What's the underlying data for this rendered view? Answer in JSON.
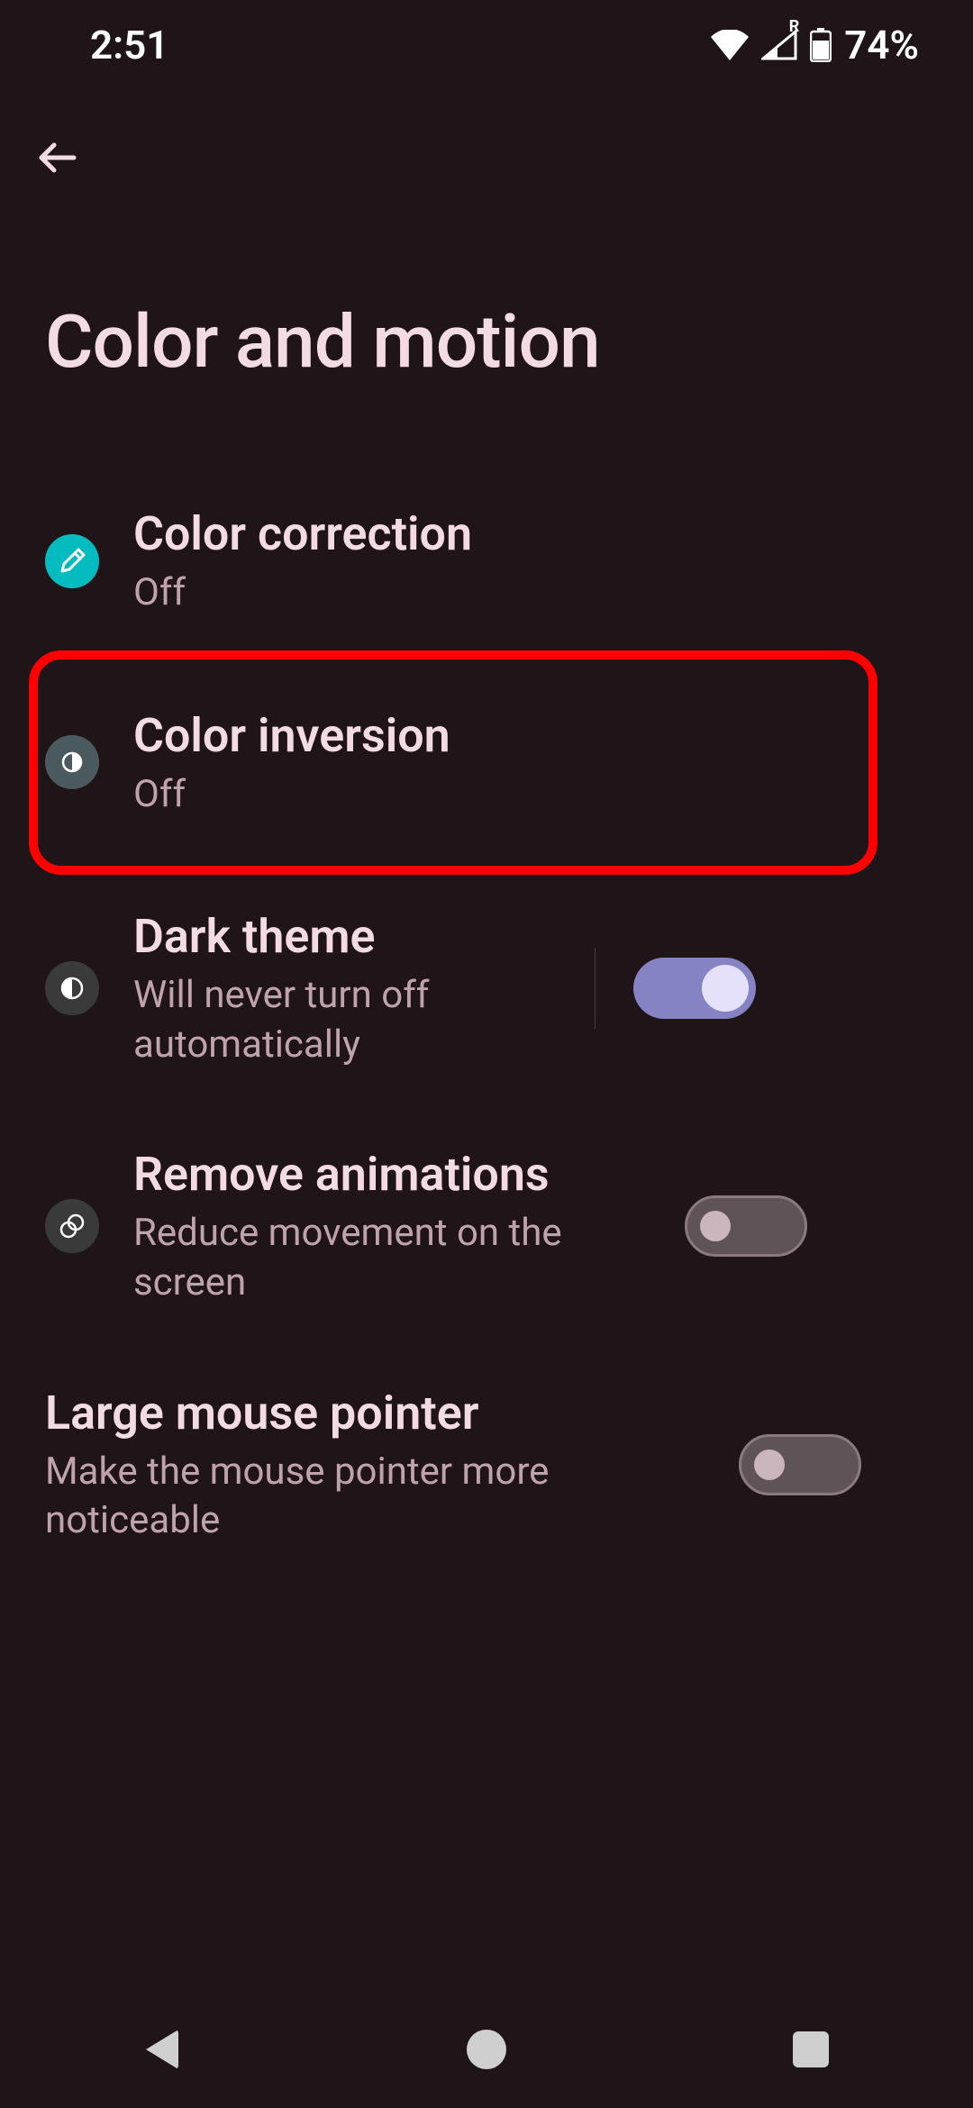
{
  "status": {
    "time": "2:51",
    "roaming_label": "R",
    "battery_text": "74%"
  },
  "page": {
    "title": "Color and motion"
  },
  "items": {
    "color_correction": {
      "title": "Color correction",
      "sub": "Off"
    },
    "color_inversion": {
      "title": "Color inversion",
      "sub": "Off"
    },
    "dark_theme": {
      "title": "Dark theme",
      "sub": "Will never turn off automatically",
      "toggle_on": true
    },
    "remove_animations": {
      "title": "Remove animations",
      "sub": "Reduce movement on the screen",
      "toggle_on": false
    },
    "large_mouse_pointer": {
      "title": "Large mouse pointer",
      "sub": "Make the mouse pointer more noticeable",
      "toggle_on": false
    }
  },
  "annotation": {
    "highlighted_item": "color_inversion",
    "highlight_color": "#ff0000"
  },
  "colors": {
    "bg": "#1f1418",
    "text_primary": "#f2dbe2",
    "text_secondary": "#bfa3ab",
    "accent_teal": "#04bcc0",
    "switch_on_track": "#8683c5",
    "switch_on_thumb": "#e6e1fa"
  }
}
